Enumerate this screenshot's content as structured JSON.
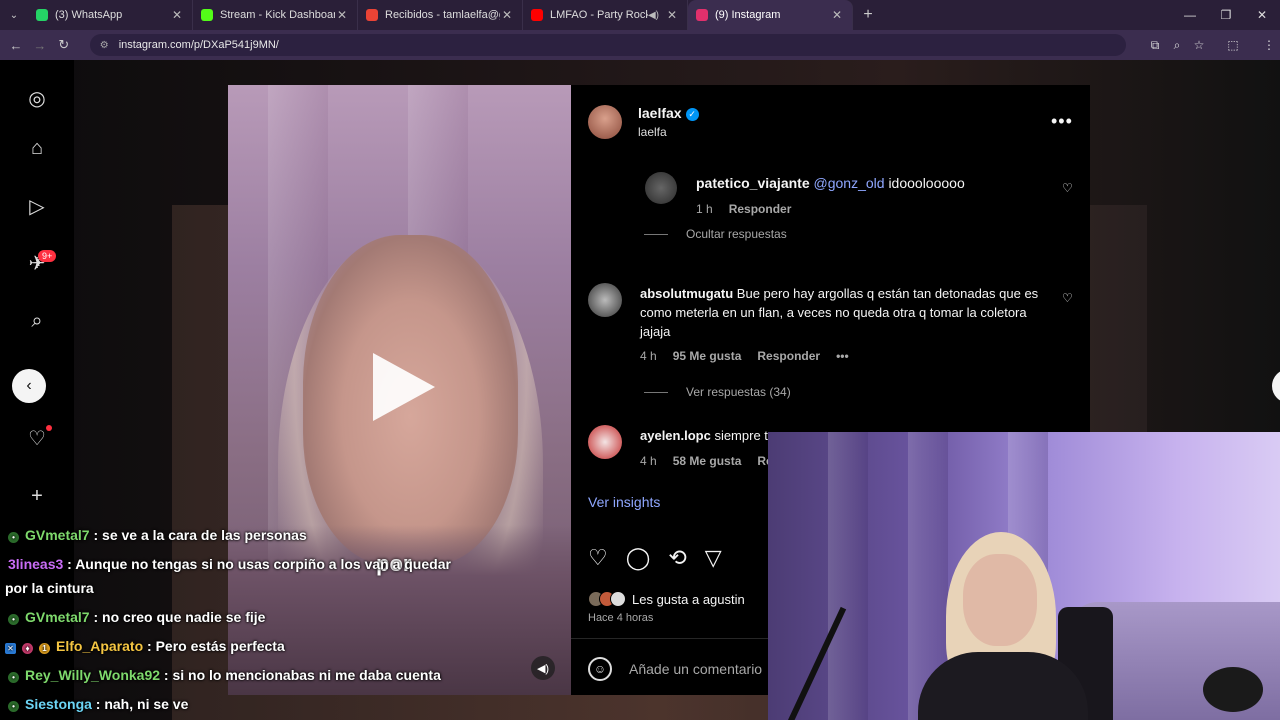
{
  "browser": {
    "tabs": [
      {
        "title": "(3) WhatsApp",
        "color": "#25d366",
        "active": false
      },
      {
        "title": "Stream - Kick Dashboard",
        "color": "#53fc18",
        "active": false
      },
      {
        "title": "Recibidos - tamlaelfa@gmail.co",
        "color": "#ea4335",
        "active": false
      },
      {
        "title": "LMFAO - Party Rock Anthe",
        "color": "#ff0000",
        "active": false
      },
      {
        "title": "(9) Instagram",
        "color": "#e1306c",
        "active": true
      }
    ],
    "url": "instagram.com/p/DXaP541j9MN/"
  },
  "sidebar": {
    "badge": "9+",
    "icons": [
      "instagram-logo-icon",
      "home-icon",
      "reels-icon",
      "messages-icon",
      "search-icon",
      "explore-icon",
      "notifications-icon",
      "create-icon"
    ]
  },
  "post": {
    "username": "laelfax",
    "subtitle": "laelfa",
    "caption_word": "por",
    "comments": [
      {
        "user": "patetico_viajante",
        "mention": "@gonz_old",
        "text": "idooolooooo",
        "time": "1 h",
        "reply": "Responder"
      },
      {
        "user": "absolutmugatu",
        "text": "Bue pero hay argollas q están tan detonadas que es como meterla en un flan, a veces no queda otra q tomar la coletora jajaja",
        "time": "4 h",
        "likes": "95 Me gusta",
        "reply": "Responder",
        "replies": "Ver respuestas (34)"
      },
      {
        "user": "ayelen.lopc",
        "text": "siempre te ",
        "time": "4 h",
        "likes": "58 Me gusta",
        "reply": "Re"
      }
    ],
    "hide_replies": "Ocultar respuestas",
    "insights": "Ver insights",
    "likes_text": "Les gusta a agustin",
    "ago": "Hace 4 horas",
    "add_comment_placeholder": "Añade un comentario"
  },
  "chat": [
    {
      "user": "GVmetal7",
      "text": ": se ve a la cara de las personas"
    },
    {
      "user": "3lineas3",
      "text": ": Aunque no tengas si no usas corpiño a los  ",
      "text2": "van a quedar"
    },
    {
      "text": "por la cintura"
    },
    {
      "user": "GVmetal7",
      "text": ": no creo que nadie se fije"
    },
    {
      "user": "Elfo_Aparato",
      "text": ": Pero estás perfecta"
    },
    {
      "user": "Rey_Willy_Wonka92",
      "text": ": si no lo mencionabas ni me daba cuenta"
    },
    {
      "user": "Siestonga",
      "text": ": nah, ni se ve"
    }
  ]
}
